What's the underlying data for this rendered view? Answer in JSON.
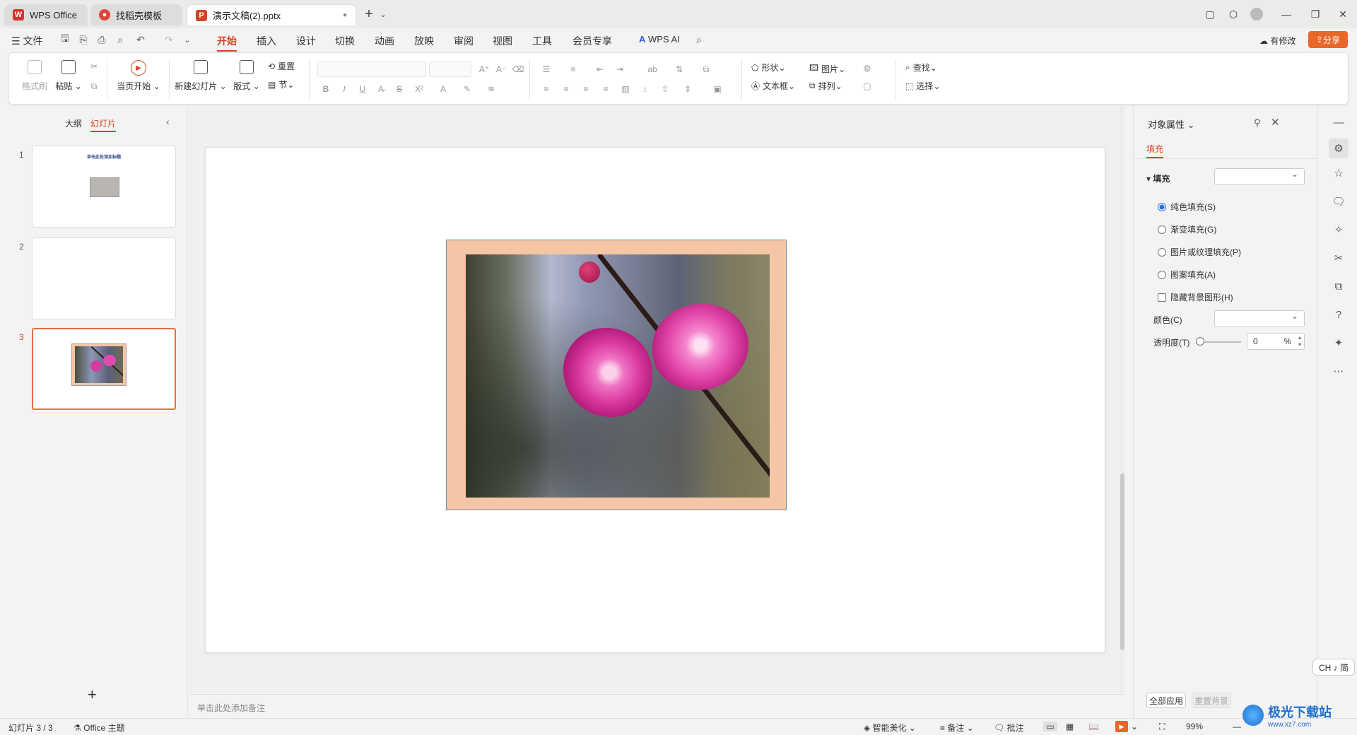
{
  "tabs": [
    {
      "label": "WPS Office",
      "icon": "wps-logo-icon"
    },
    {
      "label": "找稻壳模板",
      "icon": "docer-icon"
    },
    {
      "label": "演示文稿(2).pptx",
      "icon": "ppt-file-icon"
    }
  ],
  "menu": {
    "file": "文件",
    "items": [
      "开始",
      "插入",
      "设计",
      "切换",
      "动画",
      "放映",
      "审阅",
      "视图",
      "工具",
      "会员专享"
    ],
    "active": "开始",
    "wps_ai": "WPS AI",
    "modified": "有修改",
    "share": "分享"
  },
  "ribbon": {
    "format_painter": "格式刷",
    "paste": "粘贴",
    "from_current": "当页开始",
    "new_slide": "新建幻灯片",
    "layout": "版式",
    "reset": "重置",
    "section": "节",
    "shape": "形状",
    "picture": "图片",
    "textbox": "文本框",
    "arrange": "排列",
    "find": "查找",
    "select": "选择"
  },
  "left_panel": {
    "outline_tab": "大纲",
    "slides_tab": "幻灯片",
    "slides": [
      {
        "num": "1",
        "title": "单击此处添加标题"
      },
      {
        "num": "2",
        "title": ""
      },
      {
        "num": "3",
        "title": ""
      }
    ],
    "add": "+"
  },
  "notes_placeholder": "单击此处添加备注",
  "right_panel": {
    "title": "对象属性",
    "tab": "填充",
    "section": "填充",
    "options": [
      "纯色填充(S)",
      "渐变填充(G)",
      "图片或纹理填充(P)",
      "图案填充(A)"
    ],
    "selected_option": "纯色填充(S)",
    "hide_bg": "隐藏背景图形(H)",
    "color_label": "颜色(C)",
    "transparency_label": "透明度(T)",
    "transparency_value": "0",
    "percent": "%",
    "apply_all": "全部应用",
    "reset_bg": "重置背景"
  },
  "ime": "CH ♪ 简",
  "status": {
    "slide_count": "幻灯片 3 / 3",
    "theme": "Office 主题",
    "beautify": "智能美化",
    "notes": "备注",
    "comment": "批注",
    "zoom": "99%"
  },
  "watermark": "极光下载站",
  "watermark_url": "www.xz7.com",
  "colors": {
    "accent": "#d14424",
    "share_bg": "#e8682a",
    "frame": "#f5c6a5",
    "selected_radio": "#2d6be0"
  }
}
